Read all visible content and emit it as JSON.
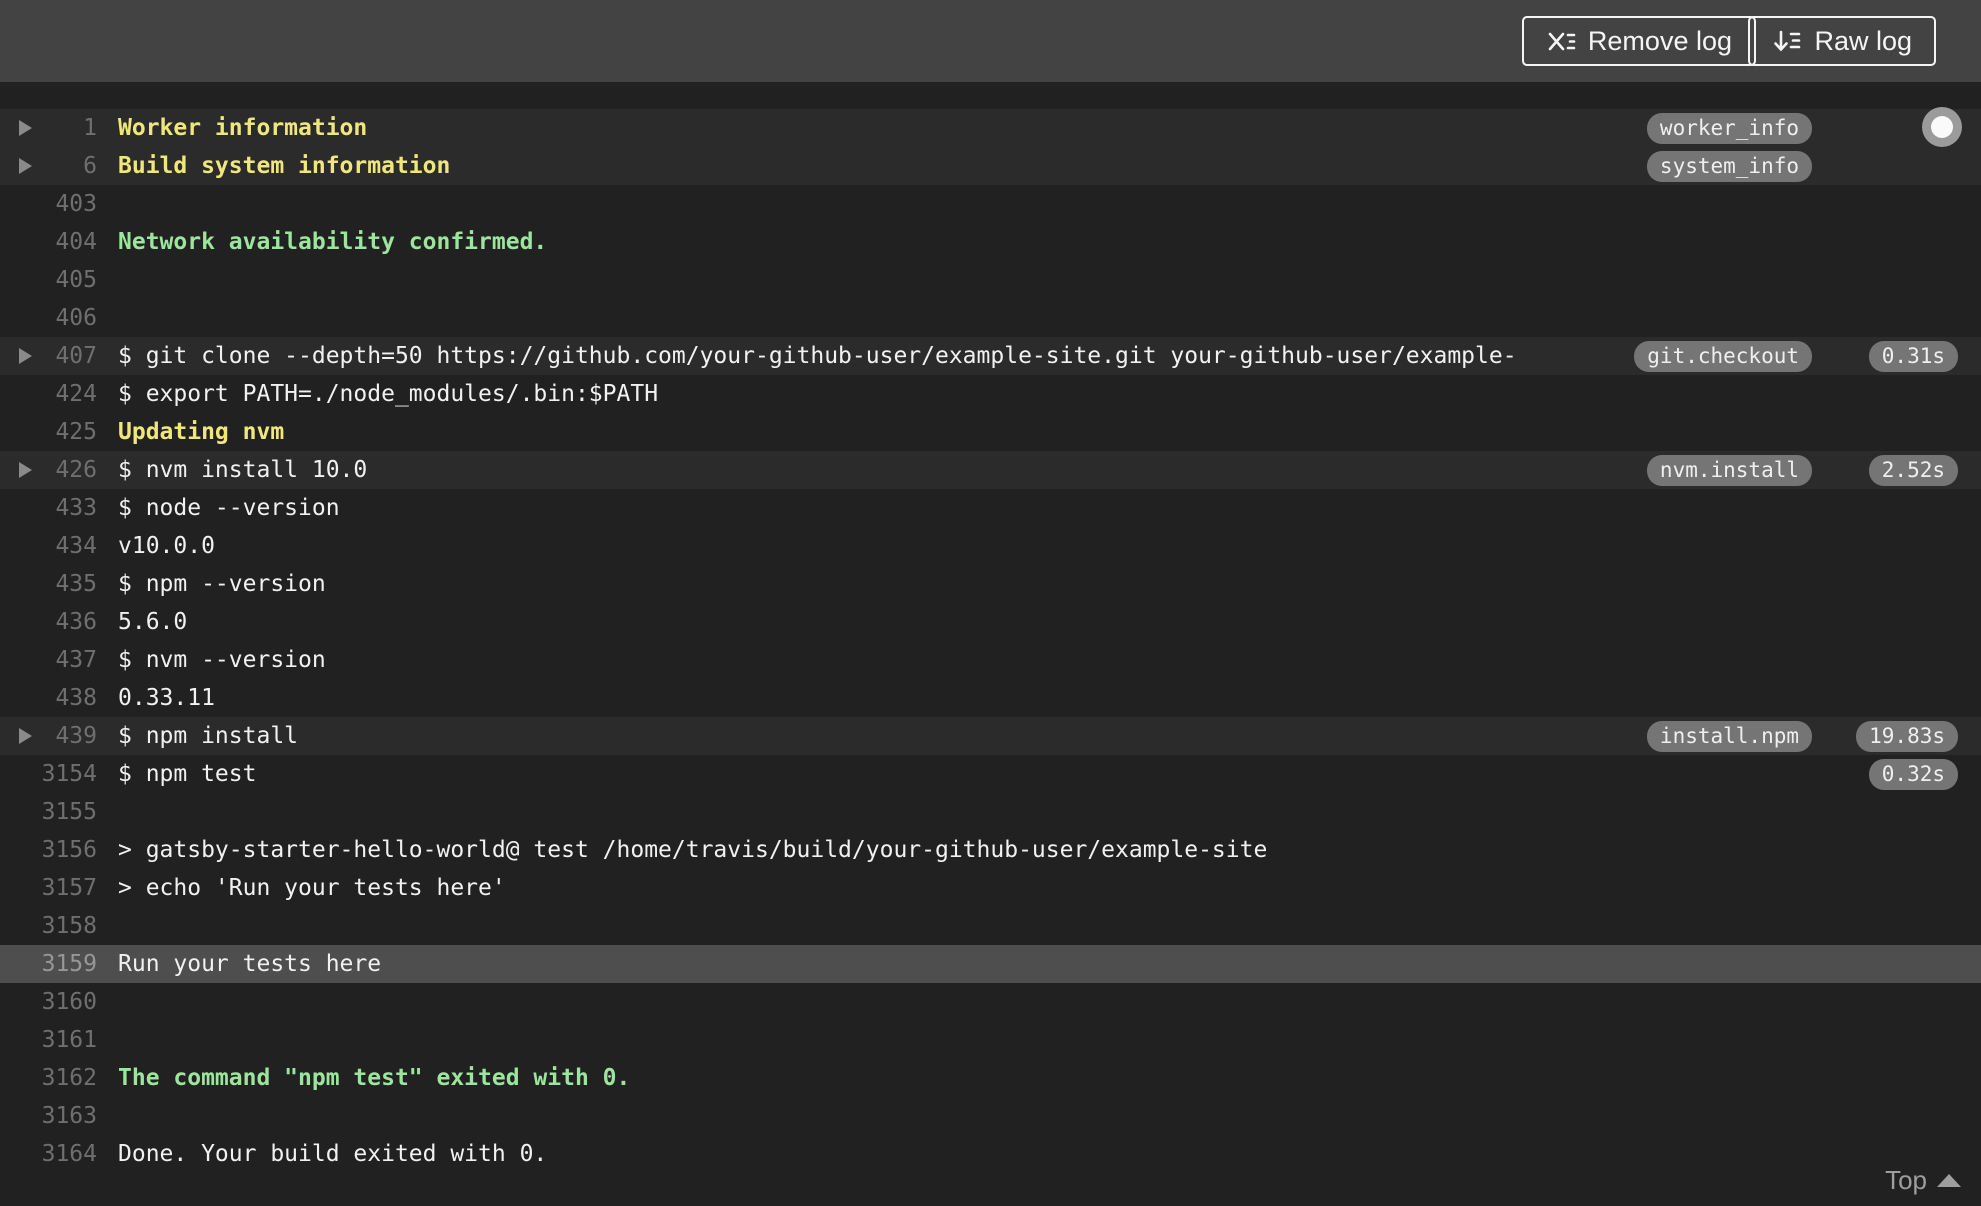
{
  "toolbar": {
    "remove_log_label": "Remove log",
    "raw_log_label": "Raw log"
  },
  "log": {
    "top_link_label": "Top",
    "rows": [
      {
        "num": "1",
        "text": "Worker information",
        "style": "yellow",
        "fold": true,
        "badge": "worker_info"
      },
      {
        "num": "6",
        "text": "Build system information",
        "style": "yellow",
        "fold": true,
        "badge": "system_info"
      },
      {
        "num": "403",
        "text": ""
      },
      {
        "num": "404",
        "text": "Network availability confirmed.",
        "style": "green"
      },
      {
        "num": "405",
        "text": ""
      },
      {
        "num": "406",
        "text": ""
      },
      {
        "num": "407",
        "text": "$ git clone --depth=50 https://github.com/your-github-user/example-site.git your-github-user/example-",
        "fold": true,
        "badge": "git.checkout",
        "duration": "0.31s"
      },
      {
        "num": "424",
        "text": "$ export PATH=./node_modules/.bin:$PATH"
      },
      {
        "num": "425",
        "text": "Updating nvm",
        "style": "yellow"
      },
      {
        "num": "426",
        "text": "$ nvm install 10.0",
        "fold": true,
        "badge": "nvm.install",
        "duration": "2.52s"
      },
      {
        "num": "433",
        "text": "$ node --version"
      },
      {
        "num": "434",
        "text": "v10.0.0"
      },
      {
        "num": "435",
        "text": "$ npm --version"
      },
      {
        "num": "436",
        "text": "5.6.0"
      },
      {
        "num": "437",
        "text": "$ nvm --version"
      },
      {
        "num": "438",
        "text": "0.33.11"
      },
      {
        "num": "439",
        "text": "$ npm install",
        "fold": true,
        "badge": "install.npm",
        "duration": "19.83s"
      },
      {
        "num": "3154",
        "text": "$ npm test",
        "duration": "0.32s"
      },
      {
        "num": "3155",
        "text": ""
      },
      {
        "num": "3156",
        "text": "> gatsby-starter-hello-world@ test /home/travis/build/your-github-user/example-site"
      },
      {
        "num": "3157",
        "text": "> echo 'Run your tests here'"
      },
      {
        "num": "3158",
        "text": ""
      },
      {
        "num": "3159",
        "text": "Run your tests here",
        "highlight": true
      },
      {
        "num": "3160",
        "text": ""
      },
      {
        "num": "3161",
        "text": ""
      },
      {
        "num": "3162",
        "text": "The command \"npm test\" exited with 0.",
        "style": "green"
      },
      {
        "num": "3163",
        "text": ""
      },
      {
        "num": "3164",
        "text": "Done. Your build exited with 0."
      }
    ]
  },
  "colors": {
    "topbar_bg": "#434343",
    "log_bg": "#212121",
    "fold_row_bg": "#2b2b2b",
    "highlight_row_bg": "#4e4e4e",
    "yellow_text": "#f0e77c",
    "green_text": "#9ce59c",
    "default_text": "#f1f1f1",
    "line_number": "#6f6f6f",
    "badge_bg": "#757575"
  }
}
